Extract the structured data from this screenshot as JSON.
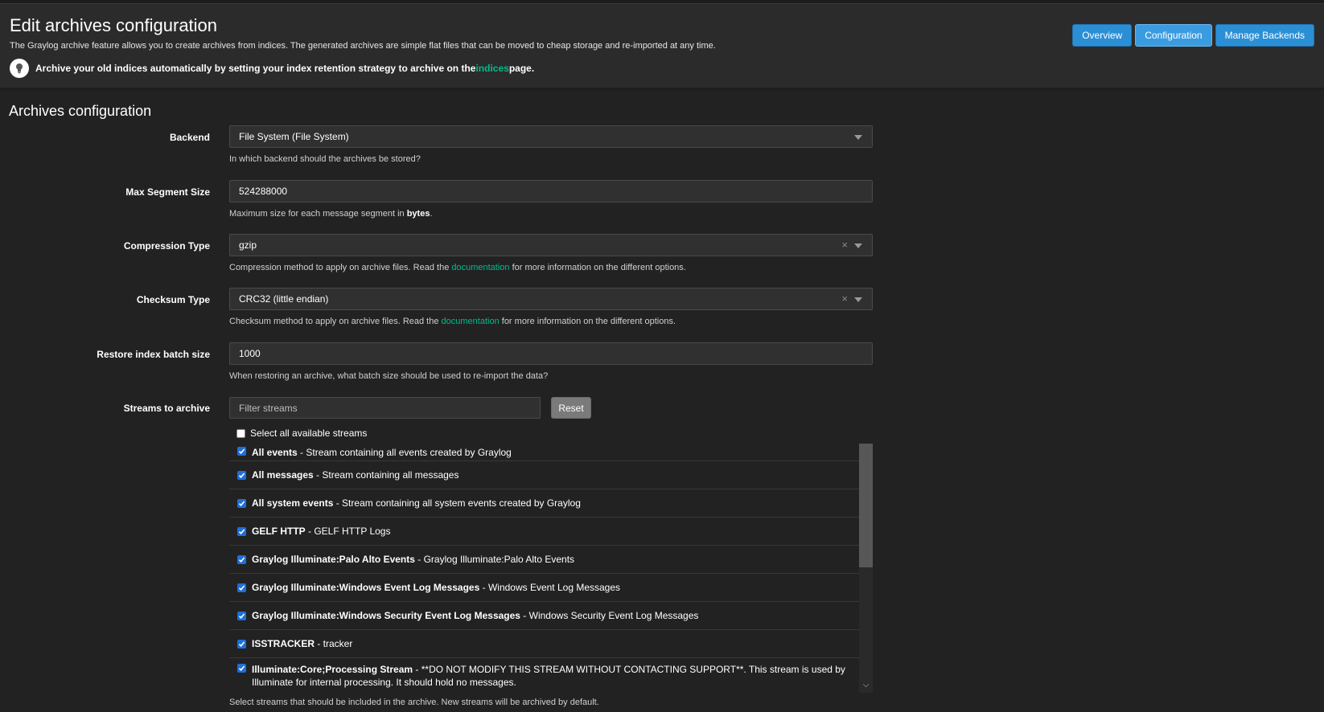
{
  "header": {
    "title": "Edit archives configuration",
    "description": "The Graylog archive feature allows you to create archives from indices. The generated archives are simple flat files that can be moved to cheap storage and re-imported at any time.",
    "tip_before": "Archive your old indices automatically by setting your index retention strategy to archive on the ",
    "tip_link": "indices",
    "tip_after": " page.",
    "buttons": {
      "overview": "Overview",
      "configuration": "Configuration",
      "manage_backends": "Manage Backends"
    }
  },
  "section_title": "Archives configuration",
  "form": {
    "backend": {
      "label": "Backend",
      "value": "File System (File System)",
      "help": "In which backend should the archives be stored?"
    },
    "max_segment_size": {
      "label": "Max Segment Size",
      "value": "524288000",
      "help_before": "Maximum size for each message segment in ",
      "help_bold": "bytes",
      "help_after": "."
    },
    "compression_type": {
      "label": "Compression Type",
      "value": "gzip",
      "help_before": "Compression method to apply on archive files. Read the ",
      "help_link": "documentation",
      "help_after": " for more information on the different options."
    },
    "checksum_type": {
      "label": "Checksum Type",
      "value": "CRC32 (little endian)",
      "help_before": "Checksum method to apply on archive files. Read the ",
      "help_link": "documentation",
      "help_after": " for more information on the different options."
    },
    "restore_batch_size": {
      "label": "Restore index batch size",
      "value": "1000",
      "help": "When restoring an archive, what batch size should be used to re-import the data?"
    },
    "streams": {
      "label": "Streams to archive",
      "filter_placeholder": "Filter streams",
      "reset_label": "Reset",
      "select_all_label": "Select all available streams",
      "items": [
        {
          "title": "All events",
          "desc": " - Stream containing all events created by Graylog",
          "checked": true
        },
        {
          "title": "All messages",
          "desc": " - Stream containing all messages",
          "checked": true
        },
        {
          "title": "All system events",
          "desc": " - Stream containing all system events created by Graylog",
          "checked": true
        },
        {
          "title": "GELF HTTP",
          "desc": " - GELF HTTP Logs",
          "checked": true
        },
        {
          "title": "Graylog Illuminate:Palo Alto Events",
          "desc": " - Graylog Illuminate:Palo Alto Events",
          "checked": true
        },
        {
          "title": "Graylog Illuminate:Windows Event Log Messages",
          "desc": " - Windows Event Log Messages",
          "checked": true
        },
        {
          "title": "Graylog Illuminate:Windows Security Event Log Messages",
          "desc": " - Windows Security Event Log Messages",
          "checked": true
        },
        {
          "title": "ISSTRACKER",
          "desc": " - tracker",
          "checked": true
        },
        {
          "title": "Illuminate:Core;Processing Stream",
          "desc": " - **DO NOT MODIFY THIS STREAM WITHOUT CONTACTING SUPPORT**. This stream is used by Illuminate for internal processing. It should hold no messages.",
          "checked": true
        }
      ],
      "help": "Select streams that should be included in the archive. New streams will be archived by default."
    }
  }
}
